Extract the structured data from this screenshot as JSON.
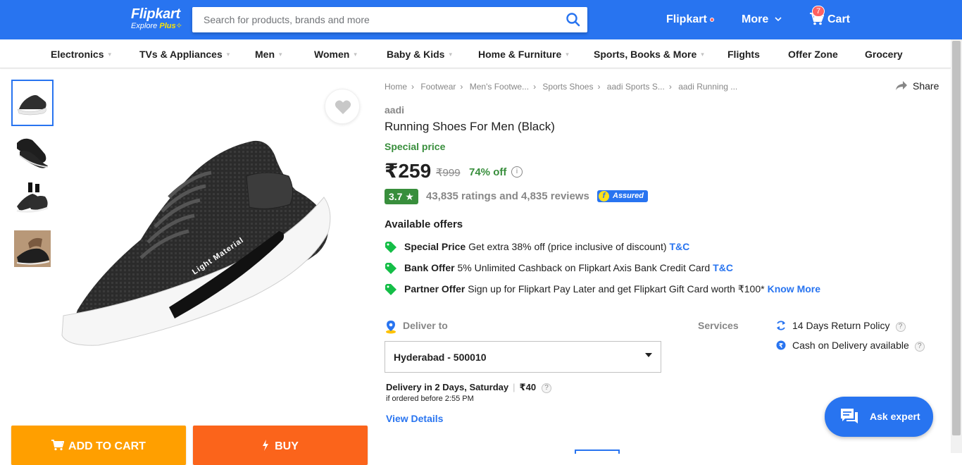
{
  "header": {
    "logo": "Flipkart",
    "logo_tagline": "Explore",
    "logo_plus": "Plus",
    "search_placeholder": "Search for products, brands and more",
    "account_label": "Flipkart",
    "more_label": "More",
    "cart_label": "Cart",
    "cart_count": "7",
    "brand_color": "#2874f0"
  },
  "nav": {
    "items": [
      {
        "label": "Electronics",
        "has_dropdown": true
      },
      {
        "label": "TVs & Appliances",
        "has_dropdown": true
      },
      {
        "label": "Men",
        "has_dropdown": true
      },
      {
        "label": "Women",
        "has_dropdown": true
      },
      {
        "label": "Baby & Kids",
        "has_dropdown": true
      },
      {
        "label": "Home & Furniture",
        "has_dropdown": true
      },
      {
        "label": "Sports, Books & More",
        "has_dropdown": true
      },
      {
        "label": "Flights",
        "has_dropdown": false
      },
      {
        "label": "Offer Zone",
        "has_dropdown": false
      },
      {
        "label": "Grocery",
        "has_dropdown": false
      }
    ]
  },
  "gallery": {
    "thumbnails": [
      "shoe-side-view",
      "shoe-pair",
      "shoe-worn",
      "shoe-laces"
    ],
    "main_print": "Light Material"
  },
  "actions": {
    "add_to_cart": "ADD TO CART",
    "buy": "BUY",
    "add_to_cart_color": "#ff9f00",
    "buy_color": "#fb641b"
  },
  "breadcrumb": [
    "Home",
    "Footwear",
    "Men's Footwe...",
    "Sports Shoes",
    "aadi Sports S...",
    "aadi Running ..."
  ],
  "share_label": "Share",
  "product": {
    "brand": "aadi",
    "title": "Running Shoes For Men  (Black)",
    "special_price_label": "Special price",
    "price": "₹259",
    "mrp": "₹999",
    "discount": "74% off",
    "rating": "3.7",
    "ratings_reviews": "43,835 ratings and 4,835 reviews",
    "assured_label": "Assured"
  },
  "offers": {
    "heading": "Available offers",
    "items": [
      {
        "type": "Special Price",
        "text": "Get extra 38% off (price inclusive of discount)",
        "link": "T&C"
      },
      {
        "type": "Bank Offer",
        "text": "5% Unlimited Cashback on Flipkart Axis Bank Credit Card",
        "link": "T&C"
      },
      {
        "type": "Partner Offer",
        "text": "Sign up for Flipkart Pay Later and get Flipkart Gift Card worth ₹100*",
        "link": "Know More"
      }
    ]
  },
  "delivery": {
    "label": "Deliver to",
    "pincode": "Hyderabad - 500010",
    "eta": "Delivery in 2 Days, Saturday",
    "charge": "₹40",
    "cutoff": "if ordered before 2:55 PM",
    "view_details": "View Details"
  },
  "services": {
    "label": "Services",
    "items": [
      "14 Days Return Policy",
      "Cash on Delivery available"
    ]
  },
  "ask_expert": "Ask expert"
}
